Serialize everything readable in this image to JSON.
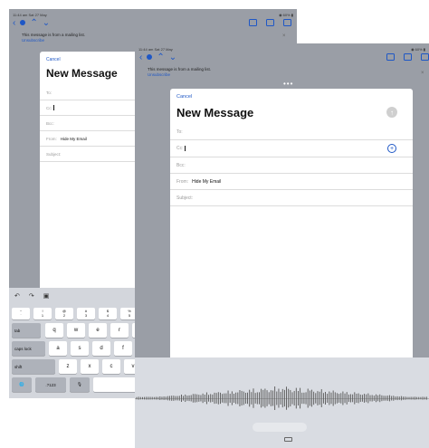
{
  "back": {
    "status_time": "11:44 am  Sat 27 May",
    "status_right": "◉ 60% ▮",
    "banner_text": "This message is from a mailing list.",
    "banner_link": "Unsubscribe",
    "banner_close": "×",
    "cancel": "Cancel",
    "title": "New Message",
    "fields": {
      "to": "To:",
      "cc": "Cc:",
      "bcc": "Bcc:",
      "from_label": "From:",
      "from_value": "Hide My Email",
      "subject": "Subject:"
    },
    "keyboard": {
      "undo_icon": "undo-icon",
      "redo_icon": "redo-icon",
      "paste_icon": "paste-icon",
      "number_row": [
        {
          "top": "~",
          "bottom": "`"
        },
        {
          "top": "!",
          "bottom": "1"
        },
        {
          "top": "@",
          "bottom": "2"
        },
        {
          "top": "#",
          "bottom": "3"
        },
        {
          "top": "$",
          "bottom": "4"
        },
        {
          "top": "%",
          "bottom": "5"
        }
      ],
      "row1_mod": "tab",
      "row1": [
        "q",
        "w",
        "e",
        "r",
        "t"
      ],
      "row2_mod": "caps lock",
      "row2": [
        "a",
        "s",
        "d",
        "f",
        "g"
      ],
      "row3_mod": "shift",
      "row3": [
        "z",
        "x",
        "c",
        "v"
      ],
      "globe": "🌐",
      "numkey": ".?123",
      "mic": "🎙"
    }
  },
  "front": {
    "status_time": "11:44 am  Sat 27 May",
    "status_right": "◉ 60% ▮",
    "banner_text": "This message is from a mailing list.",
    "banner_link": "Unsubscribe",
    "banner_close": "×",
    "grabber": "•••",
    "cancel": "Cancel",
    "title": "New Message",
    "send_glyph": "↑",
    "add_glyph": "+",
    "fields": {
      "to": "To:",
      "cc": "Cc:",
      "bcc": "Bcc:",
      "from_label": "From:",
      "from_value": "Hide My Email",
      "subject": "Subject:"
    }
  },
  "colors": {
    "accent": "#1e57c6",
    "backdrop": "#9a9ea6",
    "keyboard": "#d3d6dc"
  }
}
